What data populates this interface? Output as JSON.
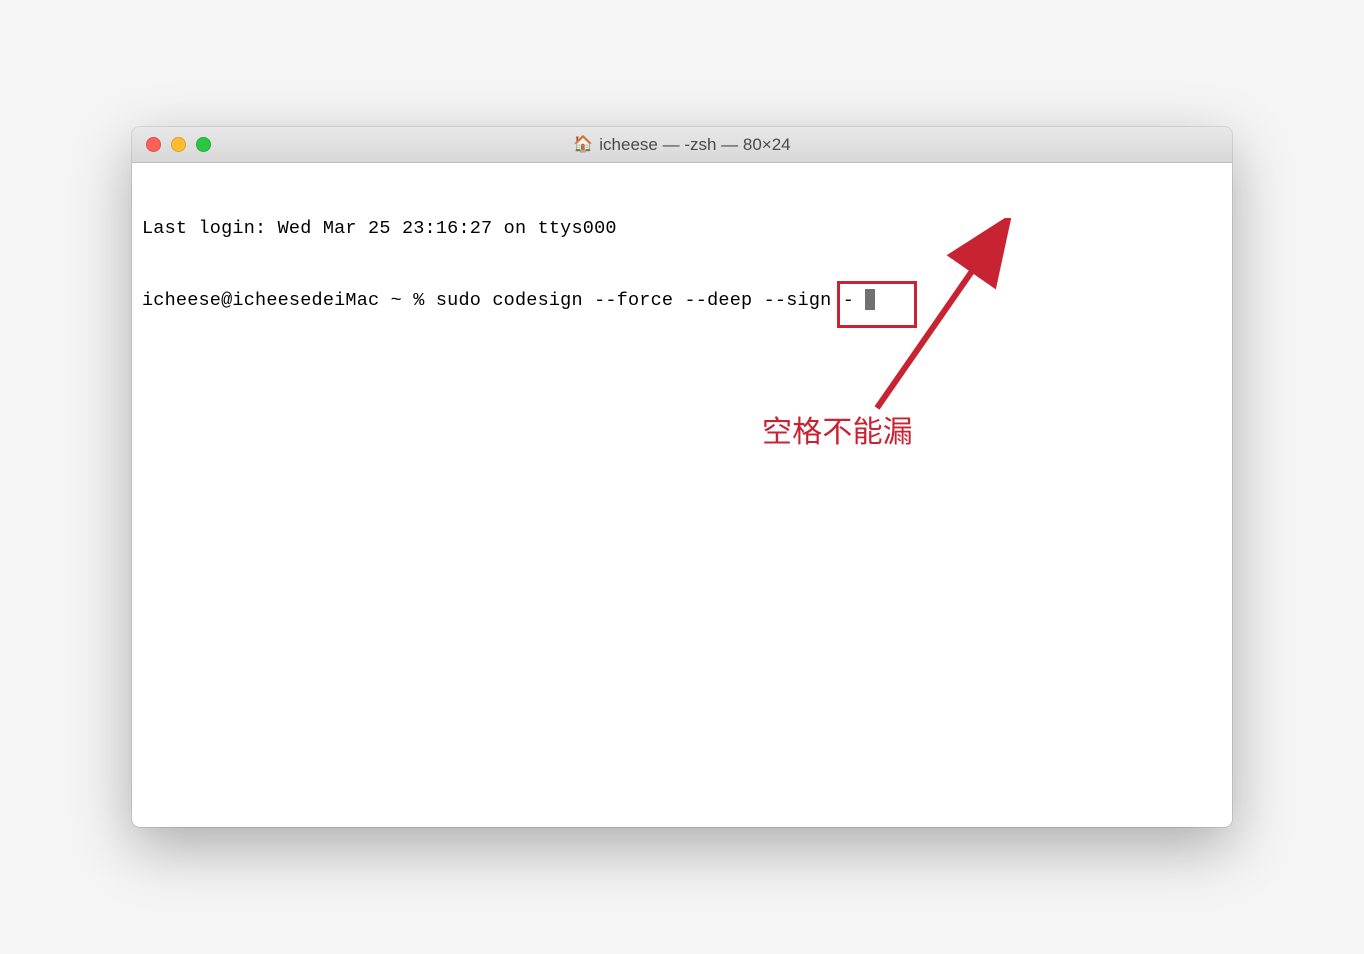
{
  "window": {
    "title": "icheese — -zsh — 80×24",
    "home_icon": "🏠"
  },
  "terminal": {
    "last_login": "Last login: Wed Mar 25 23:16:27 on ttys000",
    "prompt": "icheese@icheesedeiMac ~ % ",
    "command_prefix": "sudo codesign --force --deep --sign ",
    "command_suffix": "- "
  },
  "annotation": {
    "label": "空格不能漏",
    "color": "#c82333"
  }
}
